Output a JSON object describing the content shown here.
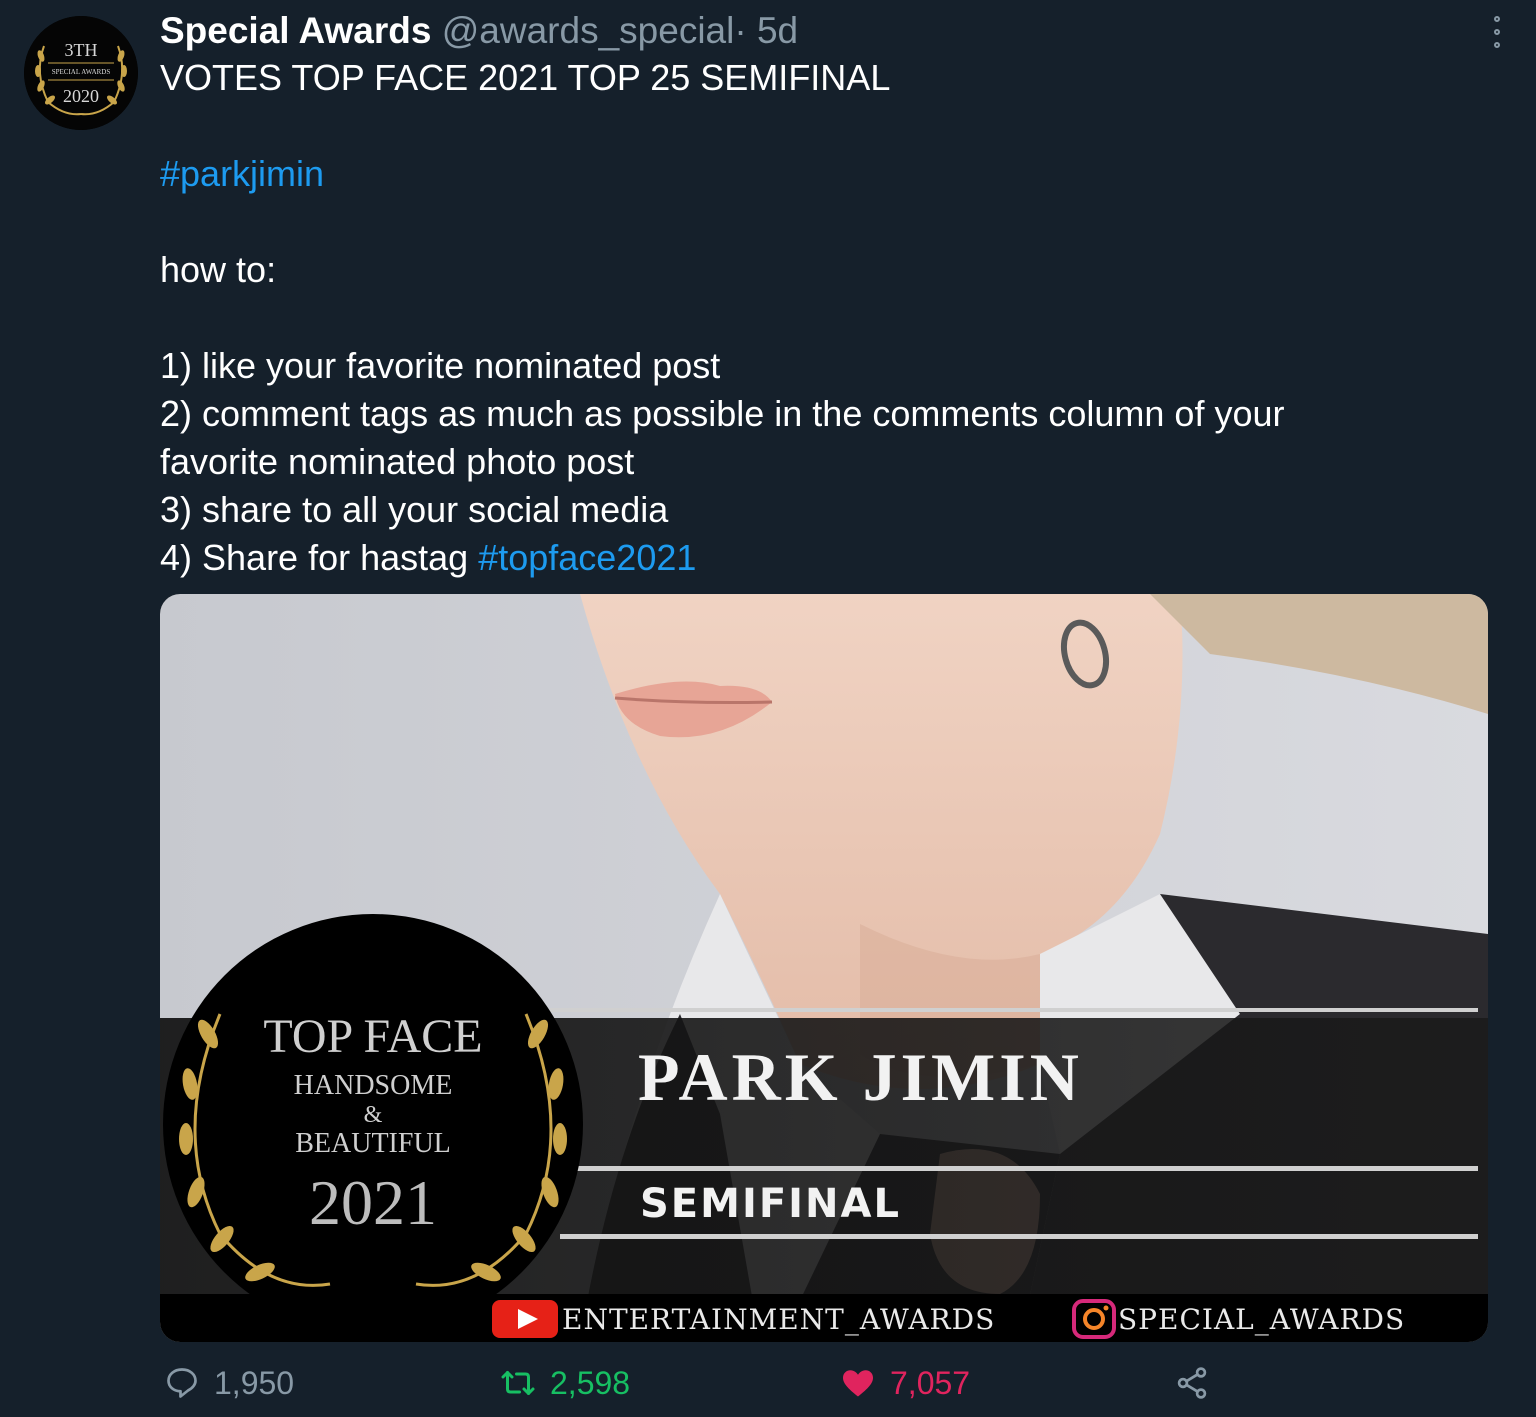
{
  "tweet": {
    "avatar_text": {
      "top": "3TH",
      "middle": "SPECIAL AWARDS",
      "bottom": "2020"
    },
    "display_name": "Special Awards",
    "handle": "@awards_special",
    "separator": "·",
    "time": "5d",
    "title_line": "VOTES TOP FACE 2021 TOP 25 SEMIFINAL",
    "hashtag": "#parkjimin",
    "how_to": "how to:",
    "steps": [
      "1) like your favorite nominated post",
      "2) comment tags as much as possible in the comments column of your",
      "favorite nominated photo post",
      "3) share to all your social media"
    ],
    "step4_prefix": "4) Share for hastag ",
    "step4_hashtag": "#topface2021"
  },
  "media": {
    "badge_line1": "TOP FACE",
    "badge_line2": "HANDSOME",
    "badge_line3": "&",
    "badge_line4": "BEAUTIFUL",
    "badge_year": "2021",
    "nominee_name": "PARK JIMIN",
    "stage": "SEMIFINAL",
    "youtube_handle": "ENTERTAINMENT_AWARDS",
    "instagram_handle": "SPECIAL_AWARDS"
  },
  "actions": {
    "reply_count": "1,950",
    "retweet_count": "2,598",
    "like_count": "7,057"
  },
  "colors": {
    "background": "#15202b",
    "link": "#1d9bf0",
    "muted": "#8899a6",
    "retweet": "#17bf63",
    "like": "#e0245e",
    "gold": "#c9a54a"
  },
  "icons": [
    "more-options-icon",
    "reply-icon",
    "retweet-icon",
    "like-icon",
    "share-icon",
    "youtube-icon",
    "instagram-icon"
  ]
}
